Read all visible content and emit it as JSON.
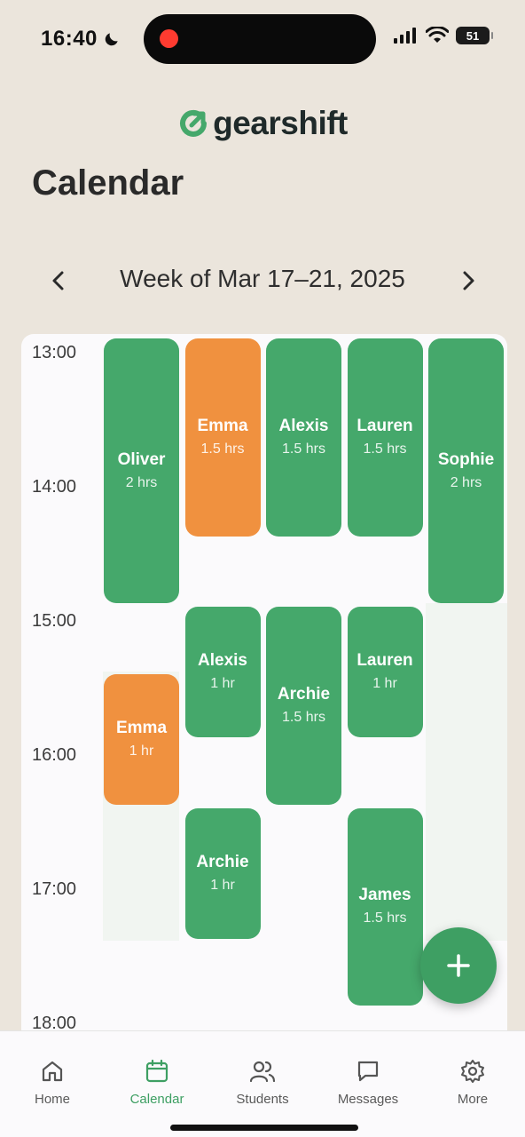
{
  "status_bar": {
    "time": "16:40",
    "battery": "51"
  },
  "app": {
    "logo_text": "gearshift",
    "brand_color": "#45a86b",
    "accent_orange": "#f0913f"
  },
  "page": {
    "title": "Calendar"
  },
  "week_nav": {
    "label": "Week of Mar 17–21, 2025"
  },
  "calendar": {
    "hours": [
      "13:00",
      "14:00",
      "15:00",
      "16:00",
      "17:00",
      "18:00"
    ],
    "events": [
      {
        "name": "Oliver",
        "duration": "2 hrs",
        "day": 1,
        "start": "13:00",
        "color": "green"
      },
      {
        "name": "Emma",
        "duration": "1.5 hrs",
        "day": 2,
        "start": "13:00",
        "color": "orange"
      },
      {
        "name": "Alexis",
        "duration": "1.5 hrs",
        "day": 3,
        "start": "13:00",
        "color": "green"
      },
      {
        "name": "Lauren",
        "duration": "1.5 hrs",
        "day": 4,
        "start": "13:00",
        "color": "green"
      },
      {
        "name": "Sophie",
        "duration": "2 hrs",
        "day": 5,
        "start": "13:00",
        "color": "green"
      },
      {
        "name": "Alexis",
        "duration": "1 hr",
        "day": 2,
        "start": "15:00",
        "color": "green"
      },
      {
        "name": "Archie",
        "duration": "1.5 hrs",
        "day": 3,
        "start": "15:00",
        "color": "green"
      },
      {
        "name": "Lauren",
        "duration": "1 hr",
        "day": 4,
        "start": "15:00",
        "color": "green"
      },
      {
        "name": "Emma",
        "duration": "1 hr",
        "day": 1,
        "start": "15:30",
        "color": "orange"
      },
      {
        "name": "Archie",
        "duration": "1 hr",
        "day": 2,
        "start": "16:30",
        "color": "green"
      },
      {
        "name": "James",
        "duration": "1.5 hrs",
        "day": 4,
        "start": "16:30",
        "color": "green"
      }
    ]
  },
  "fab": {
    "icon": "plus-icon"
  },
  "tabs": [
    {
      "label": "Home",
      "icon": "home-icon",
      "active": false
    },
    {
      "label": "Calendar",
      "icon": "calendar-icon",
      "active": true
    },
    {
      "label": "Students",
      "icon": "students-icon",
      "active": false
    },
    {
      "label": "Messages",
      "icon": "messages-icon",
      "active": false
    },
    {
      "label": "More",
      "icon": "gear-icon",
      "active": false
    }
  ]
}
